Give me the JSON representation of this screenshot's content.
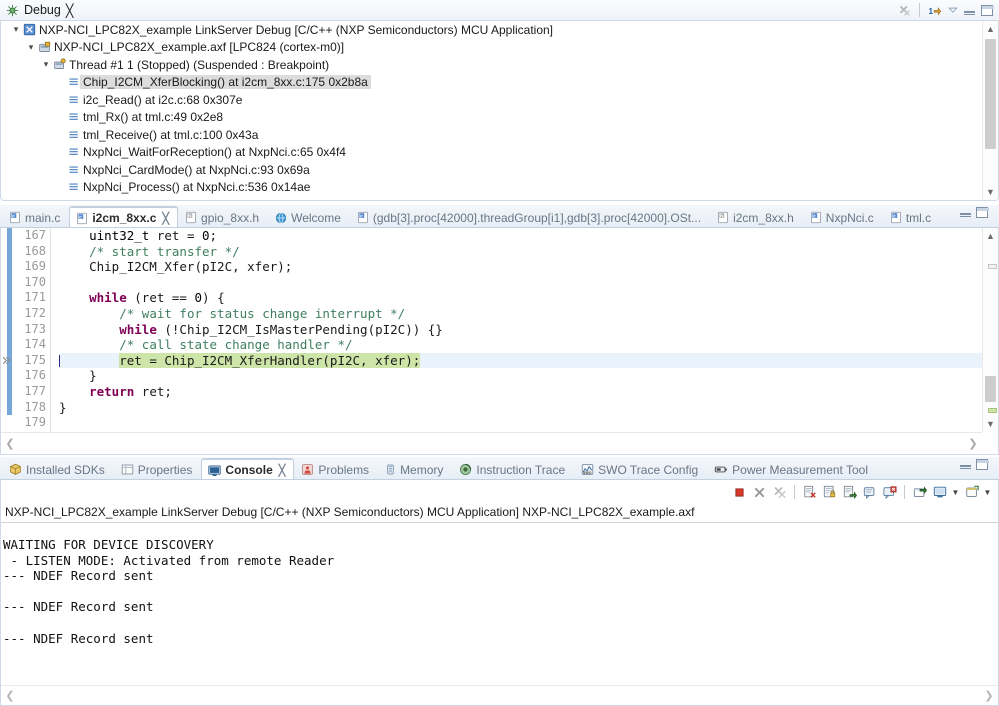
{
  "debug_view": {
    "tab_label": "Debug",
    "tab_icon": "debug-bug-icon",
    "toolbar_icons": [
      "remove-all-terminated-icon",
      "step-into-selection-icon",
      "view-menu-icon",
      "minimize-icon",
      "maximize-icon"
    ],
    "tree": [
      {
        "depth": 0,
        "twist": "⌄",
        "icon": "launch-config-icon",
        "label": "NXP-NCI_LPC82X_example LinkServer Debug [C/C++ (NXP Semiconductors) MCU Application]",
        "selected": false
      },
      {
        "depth": 1,
        "twist": "⌄",
        "icon": "process-icon",
        "label": "NXP-NCI_LPC82X_example.axf [LPC824 (cortex-m0)]",
        "selected": false
      },
      {
        "depth": 2,
        "twist": "⌄",
        "icon": "thread-icon",
        "label": "Thread #1 1 (Stopped) (Suspended : Breakpoint)",
        "selected": false
      },
      {
        "depth": 3,
        "twist": "",
        "icon": "stack-frame-icon",
        "label": "Chip_I2CM_XferBlocking() at i2cm_8xx.c:175 0x2b8a",
        "selected": true
      },
      {
        "depth": 3,
        "twist": "",
        "icon": "stack-frame-icon",
        "label": "i2c_Read() at i2c.c:68 0x307e",
        "selected": false
      },
      {
        "depth": 3,
        "twist": "",
        "icon": "stack-frame-icon",
        "label": "tml_Rx() at tml.c:49 0x2e8",
        "selected": false
      },
      {
        "depth": 3,
        "twist": "",
        "icon": "stack-frame-icon",
        "label": "tml_Receive() at tml.c:100 0x43a",
        "selected": false
      },
      {
        "depth": 3,
        "twist": "",
        "icon": "stack-frame-icon",
        "label": "NxpNci_WaitForReception() at NxpNci.c:65 0x4f4",
        "selected": false
      },
      {
        "depth": 3,
        "twist": "",
        "icon": "stack-frame-icon",
        "label": "NxpNci_CardMode() at NxpNci.c:93 0x69a",
        "selected": false
      },
      {
        "depth": 3,
        "twist": "",
        "icon": "stack-frame-icon",
        "label": "NxpNci_Process() at NxpNci.c:536 0x14ae",
        "selected": false
      }
    ]
  },
  "editor": {
    "tabs": [
      {
        "label": "main.c",
        "icon": "c-file-icon",
        "active": false,
        "closable": false
      },
      {
        "label": "i2cm_8xx.c",
        "icon": "c-file-icon",
        "active": true,
        "closable": true
      },
      {
        "label": "gpio_8xx.h",
        "icon": "h-file-icon",
        "active": false,
        "closable": false
      },
      {
        "label": "Welcome",
        "icon": "welcome-globe-icon",
        "active": false,
        "closable": false
      },
      {
        "label": "(gdb[3].proc[42000].threadGroup[i1],gdb[3].proc[42000].OSt...",
        "icon": "c-file-icon",
        "active": false,
        "closable": false
      },
      {
        "label": "i2cm_8xx.h",
        "icon": "h-file-icon",
        "active": false,
        "closable": false
      },
      {
        "label": "NxpNci.c",
        "icon": "c-file-icon",
        "active": false,
        "closable": false
      },
      {
        "label": "tml.c",
        "icon": "c-file-icon",
        "active": false,
        "closable": false
      }
    ],
    "first_line": 167,
    "current_line": 175,
    "lines": [
      {
        "n": 167,
        "html": "    <span class=\"typ\">uint32_t</span> ret = <span class=\"num\">0</span>;"
      },
      {
        "n": 168,
        "html": "    <span class=\"cmt\">/* start transfer */</span>"
      },
      {
        "n": 169,
        "html": "    Chip_I2CM_Xfer(pI2C, xfer);"
      },
      {
        "n": 170,
        "html": ""
      },
      {
        "n": 171,
        "html": "    <span class=\"kw\">while</span> (ret == <span class=\"num\">0</span>) {"
      },
      {
        "n": 172,
        "html": "        <span class=\"cmt\">/* wait for status change interrupt */</span>"
      },
      {
        "n": 173,
        "html": "        <span class=\"kw\">while</span> (!Chip_I2CM_IsMasterPending(pI2C)) {}"
      },
      {
        "n": 174,
        "html": "        <span class=\"cmt\">/* call state change handler */</span>"
      },
      {
        "n": 175,
        "html": "<span class=\"caret\"></span>        <span class=\"hl\">ret = Chip_I2CM_XferHandler(pI2C, xfer);</span>"
      },
      {
        "n": 176,
        "html": "    }"
      },
      {
        "n": 177,
        "html": "    <span class=\"kw\">return</span> ret;"
      },
      {
        "n": 178,
        "html": "}"
      },
      {
        "n": 179,
        "html": ""
      }
    ],
    "breakpoint_marker": "debug-current-ip-arrow",
    "minimize_icon": "minimize-icon",
    "maximize_icon": "maximize-icon"
  },
  "console_panel": {
    "tabs": [
      {
        "label": "Installed SDKs",
        "icon": "sdk-box-icon",
        "active": false,
        "closable": false
      },
      {
        "label": "Properties",
        "icon": "properties-icon",
        "active": false,
        "closable": false
      },
      {
        "label": "Console",
        "icon": "console-icon",
        "active": true,
        "closable": true
      },
      {
        "label": "Problems",
        "icon": "problems-icon",
        "active": false,
        "closable": false
      },
      {
        "label": "Memory",
        "icon": "memory-icon",
        "active": false,
        "closable": false
      },
      {
        "label": "Instruction Trace",
        "icon": "instruction-trace-icon",
        "active": false,
        "closable": false
      },
      {
        "label": "SWO Trace Config",
        "icon": "swo-trace-icon",
        "active": false,
        "closable": false
      },
      {
        "label": "Power Measurement Tool",
        "icon": "power-measurement-icon",
        "active": false,
        "closable": false
      }
    ],
    "toolbar_icons": [
      "terminate-icon",
      "remove-launch-icon",
      "remove-all-terminated-icon",
      "clear-console-icon",
      "scroll-lock-icon",
      "show-console-on-output-icon",
      "pin-console-icon",
      "display-selected-console-icon",
      "open-console-icon",
      "select-console-icon",
      "new-console-view-icon"
    ],
    "title": "NXP-NCI_LPC82X_example LinkServer Debug [C/C++ (NXP Semiconductors) MCU Application] NXP-NCI_LPC82X_example.axf",
    "output": "WAITING FOR DEVICE DISCOVERY\n - LISTEN MODE: Activated from remote Reader\n--- NDEF Record sent\n\n--- NDEF Record sent\n\n--- NDEF Record sent",
    "minimize_icon": "minimize-icon",
    "maximize_icon": "maximize-icon"
  },
  "colors": {
    "selection_bg": "#dcdcdc",
    "current_line_bg": "#eaf2fb",
    "highlight_bg": "#cde5a8",
    "keyword": "#7f0055",
    "comment": "#3f7f5f",
    "tab_active_bg": "#ffffff",
    "panel_border": "#cfdae6"
  }
}
